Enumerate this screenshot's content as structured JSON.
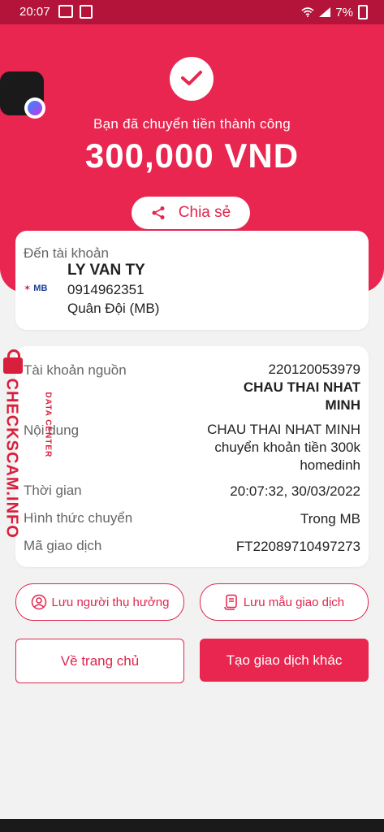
{
  "statusbar": {
    "time": "20:07",
    "battery": "7%"
  },
  "hero": {
    "success_text": "Bạn đã chuyển tiền thành công",
    "amount": "300,000 VND",
    "share_label": "Chia sẻ"
  },
  "recipient": {
    "label": "Đến tài khoản",
    "bank_logo": "MB",
    "name": "LY VAN TY",
    "account": "0914962351",
    "bank": "Quân Đội (MB)"
  },
  "details": {
    "source_label": "Tài khoản nguồn",
    "source_account": "220120053979",
    "source_name_line1": "CHAU THAI NHAT",
    "source_name_line2": "MINH",
    "content_label": "Nội dung",
    "content_line1": "CHAU THAI NHAT MINH",
    "content_line2": "chuyển khoản tiền 300k",
    "content_line3": "homedinh",
    "time_label": "Thời gian",
    "time_value": "20:07:32, 30/03/2022",
    "type_label": "Hình thức chuyển",
    "type_value": "Trong MB",
    "txn_label": "Mã giao dịch",
    "txn_value": "FT22089710497273"
  },
  "actions": {
    "save_beneficiary": "Lưu người thụ hưởng",
    "save_template": "Lưu mẫu giao dịch",
    "home": "Về trang chủ",
    "new_txn": "Tạo giao dịch khác"
  },
  "watermark": {
    "text": "CHECKSCAM.INFO",
    "sub": "DATA CENTER"
  },
  "colors": {
    "primary": "#e8264f",
    "statusbar": "#b5143a"
  }
}
